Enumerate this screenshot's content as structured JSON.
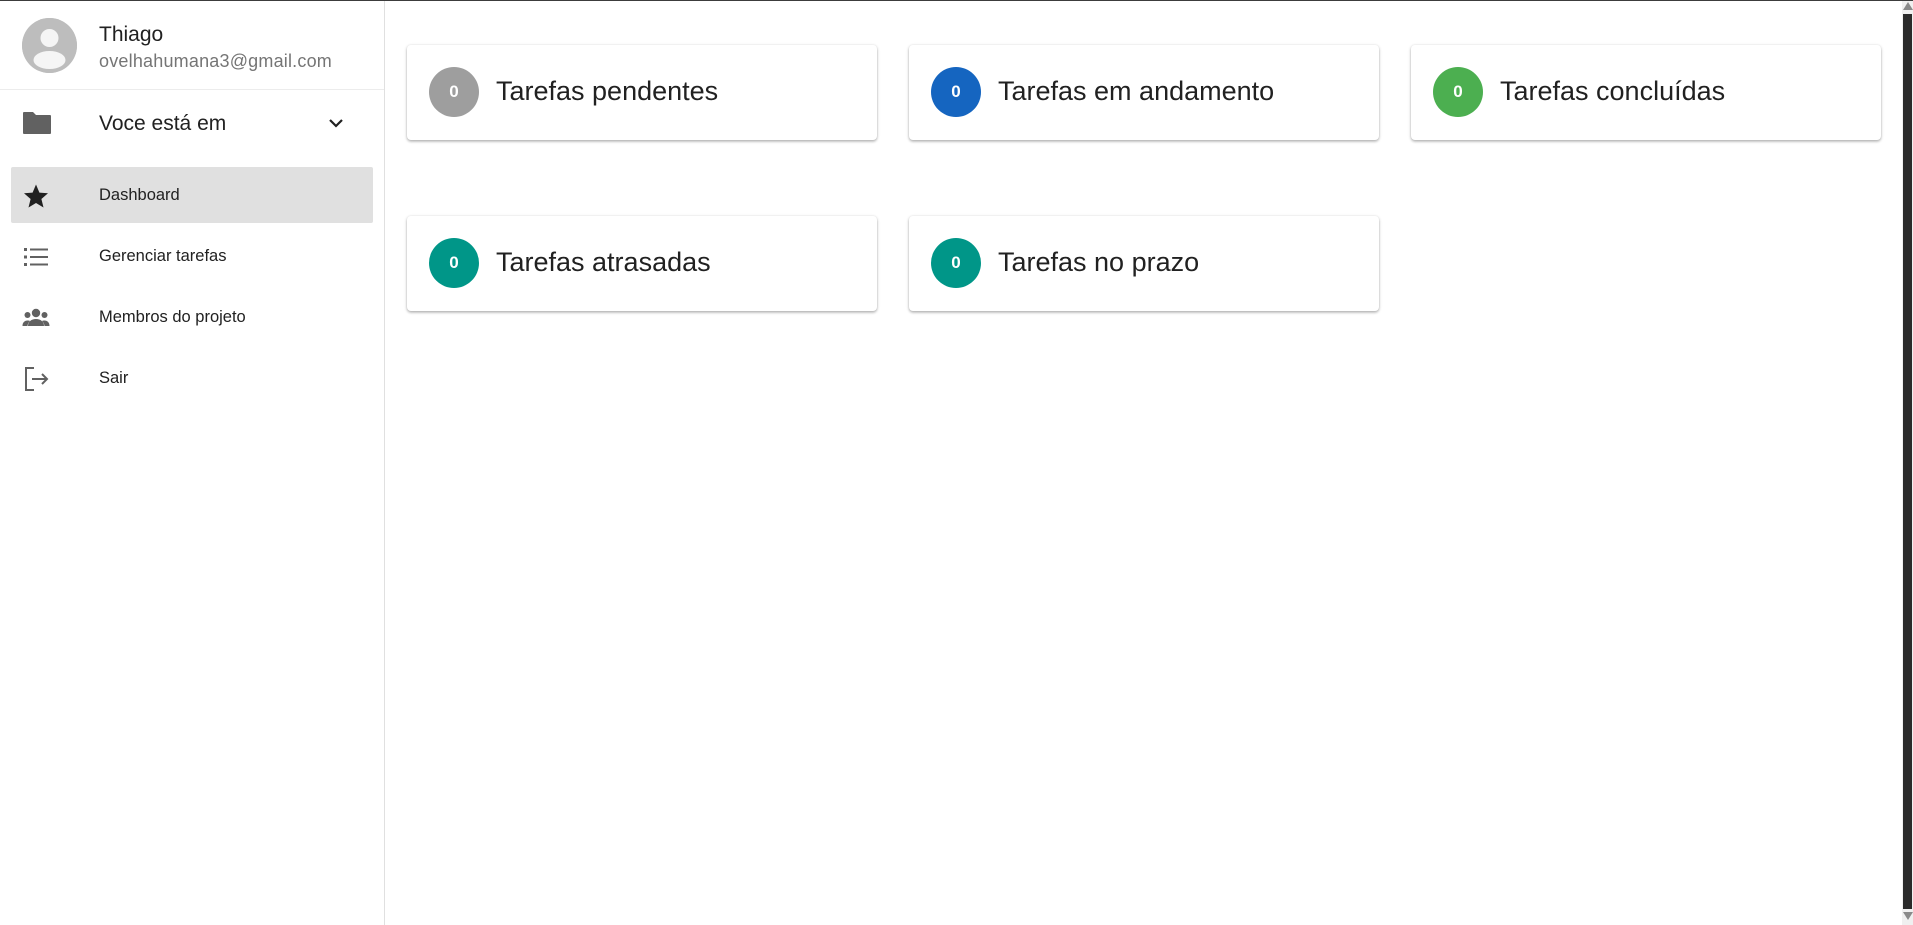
{
  "user": {
    "name": "Thiago",
    "email": "ovelhahumana3@gmail.com",
    "avatar_icon": "person-icon"
  },
  "project_selector": {
    "label": "Voce está em",
    "icon": "folder-icon",
    "dropdown_icon": "chevron-down-icon"
  },
  "sidebar": {
    "items": [
      {
        "label": "Dashboard",
        "icon": "star-icon",
        "active": true
      },
      {
        "label": "Gerenciar tarefas",
        "icon": "list-icon",
        "active": false
      },
      {
        "label": "Membros do projeto",
        "icon": "people-icon",
        "active": false
      },
      {
        "label": "Sair",
        "icon": "logout-icon",
        "active": false
      }
    ]
  },
  "cards": [
    {
      "count": "0",
      "title": "Tarefas pendentes",
      "color": "#9e9e9e"
    },
    {
      "count": "0",
      "title": "Tarefas em andamento",
      "color": "#1565c0"
    },
    {
      "count": "0",
      "title": "Tarefas concluídas",
      "color": "#4caf50"
    },
    {
      "count": "0",
      "title": "Tarefas atrasadas",
      "color": "#009688"
    },
    {
      "count": "0",
      "title": "Tarefas no prazo",
      "color": "#009688"
    }
  ],
  "colors": {
    "active_nav_bg": "#e0e0e0",
    "icon_gray": "#616161"
  }
}
